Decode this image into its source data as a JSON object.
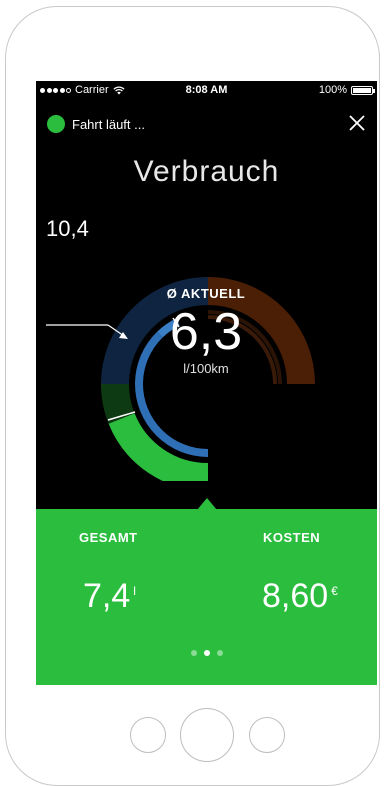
{
  "status_bar": {
    "carrier": "Carrier",
    "time": "8:08 AM",
    "battery": "100%"
  },
  "header": {
    "trip_status": "Fahrt läuft ...",
    "close_icon": "close-icon"
  },
  "title": "Verbrauch",
  "gauge": {
    "callout_value": "10,4",
    "center_label": "Ø AKTUELL",
    "center_value": "6,3",
    "center_unit": "l/100km",
    "colors": {
      "outer_track": "#0f2440",
      "outer_brown": "#4a1f05",
      "outer_green": "#2bbd3e",
      "outer_dark_green": "#0d3a12",
      "inner_blue": "#2f6fb5",
      "inner_brown": "#3a1a08"
    }
  },
  "stats": {
    "total_label": "GESAMT",
    "total_value": "7,4",
    "total_unit": "l",
    "cost_label": "KOSTEN",
    "cost_value": "8,60",
    "cost_unit": "€"
  },
  "pagination": {
    "count": 3,
    "active": 1
  },
  "colors": {
    "accent": "#2bbd3e",
    "background": "#000000"
  }
}
